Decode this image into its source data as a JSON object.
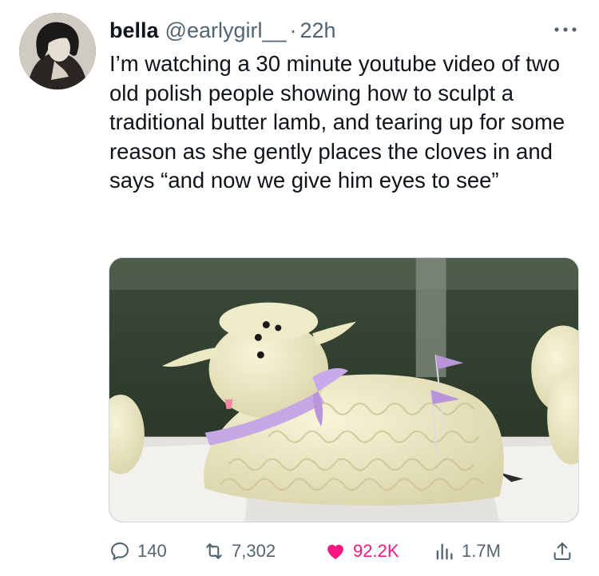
{
  "author": {
    "display_name": "bella",
    "handle": "@earlygirl__",
    "separator": "·",
    "timestamp": "22h",
    "avatar_icon": "avatar-photo"
  },
  "more_icon": "more-horizontal-icon",
  "tweet": {
    "text": "I’m watching a 30 minute youtube video of two old polish people showing how to sculpt a traditional butter lamb, and tearing up for some reason as she gently places the cloves in and says “and now we give him eyes to see”"
  },
  "media": {
    "icon": "butter-lamb-photo"
  },
  "actions": {
    "replies": "140",
    "retweets": "7,302",
    "likes": "92.2K",
    "views": "1.7M"
  },
  "colors": {
    "text": "#0f1419",
    "secondary": "#536471",
    "like": "#f91880",
    "border": "#cfd9de"
  }
}
